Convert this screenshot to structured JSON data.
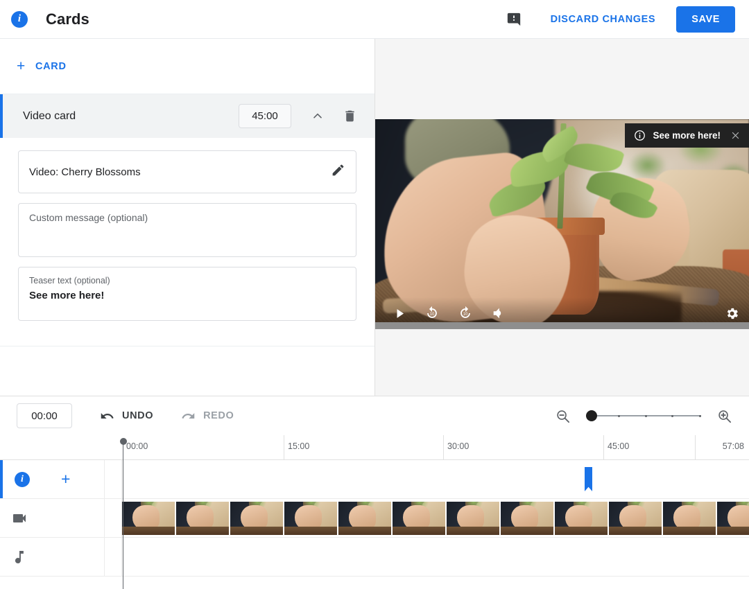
{
  "topbar": {
    "info_icon": "info-icon",
    "title": "Cards",
    "feedback_icon": "feedback-icon",
    "discard_label": "DISCARD CHANGES",
    "save_label": "SAVE",
    "accent_color": "#1a73e8"
  },
  "left_panel": {
    "add_card": {
      "plus": "+",
      "label": "CARD"
    },
    "card": {
      "title": "Video card",
      "time": "45:00",
      "collapse_icon": "chevron-up-icon",
      "delete_icon": "trash-icon",
      "video_field": {
        "value": "Video: Cherry Blossoms",
        "edit_icon": "pencil-icon"
      },
      "custom_message": {
        "placeholder": "Custom message (optional)",
        "value": ""
      },
      "teaser": {
        "label": "Teaser text (optional)",
        "value": "See more here!"
      }
    }
  },
  "preview": {
    "teaser_chip": {
      "icon": "info-circle-icon",
      "text": "See more here!",
      "close_icon": "close-icon"
    },
    "controls": {
      "play": "play-icon",
      "rewind": "replay-10-icon",
      "forward": "forward-10-icon",
      "volume": "volume-on-icon",
      "settings": "gear-icon"
    }
  },
  "timeline": {
    "current_time": "00:00",
    "undo_label": "UNDO",
    "redo_label": "REDO",
    "undo_icon": "undo-arrow-icon",
    "redo_icon": "redo-arrow-icon",
    "zoom_out_icon": "zoom-out-icon",
    "zoom_in_icon": "zoom-in-icon",
    "zoom_level": 0,
    "ruler": {
      "labels": [
        "00:00",
        "15:00",
        "30:00",
        "45:00"
      ],
      "duration_label": "57:08"
    },
    "tracks": [
      {
        "name": "cards-track",
        "icon": "info-icon",
        "add": "+"
      },
      {
        "name": "video-track",
        "icon": "videocam-icon"
      },
      {
        "name": "audio-track",
        "icon": "music-note-icon"
      }
    ],
    "card_marker_time": "45:00"
  }
}
